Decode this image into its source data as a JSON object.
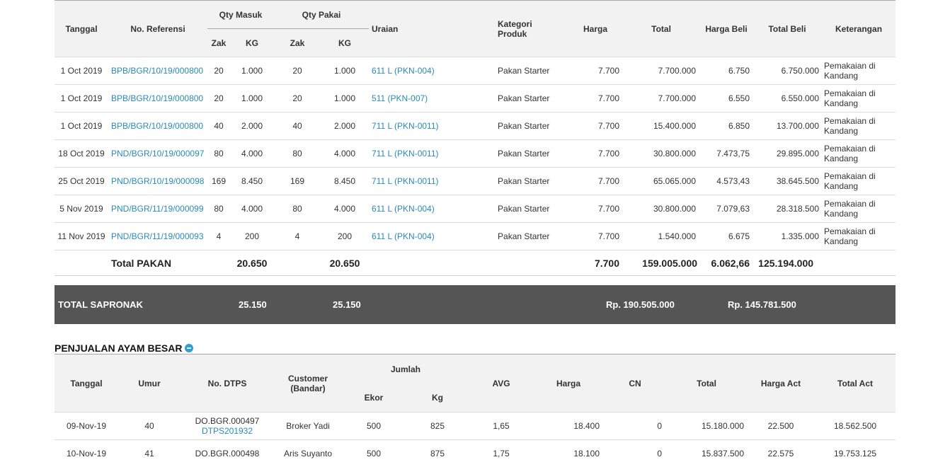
{
  "pakan": {
    "headers": {
      "tanggal": "Tanggal",
      "no_ref": "No. Referensi",
      "qty_masuk": "Qty Masuk",
      "qty_pakai": "Qty Pakai",
      "zak": "Zak",
      "kg": "KG",
      "uraian": "Uraian",
      "kategori": "Kategori Produk",
      "harga": "Harga",
      "total": "Total",
      "harga_beli": "Harga Beli",
      "total_beli": "Total Beli",
      "keterangan": "Keterangan"
    },
    "rows": [
      {
        "tanggal": "1 Oct 2019",
        "ref": "BPB/BGR/10/19/000800",
        "zak_in": "20",
        "kg_in": "1.000",
        "zak_use": "20",
        "kg_use": "1.000",
        "uraian": "611 L (PKN-004)",
        "kategori": "Pakan Starter",
        "harga": "7.700",
        "total": "7.700.000",
        "harga_beli": "6.750",
        "total_beli": "6.750.000",
        "ket": "Pemakaian di Kandang"
      },
      {
        "tanggal": "1 Oct 2019",
        "ref": "BPB/BGR/10/19/000800",
        "zak_in": "20",
        "kg_in": "1.000",
        "zak_use": "20",
        "kg_use": "1.000",
        "uraian": "511 (PKN-007)",
        "kategori": "Pakan Starter",
        "harga": "7.700",
        "total": "7.700.000",
        "harga_beli": "6.550",
        "total_beli": "6.550.000",
        "ket": "Pemakaian di Kandang"
      },
      {
        "tanggal": "1 Oct 2019",
        "ref": "BPB/BGR/10/19/000800",
        "zak_in": "40",
        "kg_in": "2.000",
        "zak_use": "40",
        "kg_use": "2.000",
        "uraian": "711 L (PKN-0011)",
        "kategori": "Pakan Starter",
        "harga": "7.700",
        "total": "15.400.000",
        "harga_beli": "6.850",
        "total_beli": "13.700.000",
        "ket": "Pemakaian di Kandang"
      },
      {
        "tanggal": "18 Oct 2019",
        "ref": "PND/BGR/10/19/000097",
        "zak_in": "80",
        "kg_in": "4.000",
        "zak_use": "80",
        "kg_use": "4.000",
        "uraian": "711 L (PKN-0011)",
        "kategori": "Pakan Starter",
        "harga": "7.700",
        "total": "30.800.000",
        "harga_beli": "7.473,75",
        "total_beli": "29.895.000",
        "ket": "Pemakaian di Kandang"
      },
      {
        "tanggal": "25 Oct 2019",
        "ref": "PND/BGR/10/19/000098",
        "zak_in": "169",
        "kg_in": "8.450",
        "zak_use": "169",
        "kg_use": "8.450",
        "uraian": "711 L (PKN-0011)",
        "kategori": "Pakan Starter",
        "harga": "7.700",
        "total": "65.065.000",
        "harga_beli": "4.573,43",
        "total_beli": "38.645.500",
        "ket": "Pemakaian di Kandang"
      },
      {
        "tanggal": "5 Nov 2019",
        "ref": "PND/BGR/11/19/000099",
        "zak_in": "80",
        "kg_in": "4.000",
        "zak_use": "80",
        "kg_use": "4.000",
        "uraian": "611 L (PKN-004)",
        "kategori": "Pakan Starter",
        "harga": "7.700",
        "total": "30.800.000",
        "harga_beli": "7.079,63",
        "total_beli": "28.318.500",
        "ket": "Pemakaian di Kandang"
      },
      {
        "tanggal": "11 Nov 2019",
        "ref": "PND/BGR/11/19/000093",
        "zak_in": "4",
        "kg_in": "200",
        "zak_use": "4",
        "kg_use": "200",
        "uraian": "611 L (PKN-004)",
        "kategori": "Pakan Starter",
        "harga": "7.700",
        "total": "1.540.000",
        "harga_beli": "6.675",
        "total_beli": "1.335.000",
        "ket": "Pemakaian di Kandang"
      }
    ],
    "total": {
      "label": "Total PAKAN",
      "kg_in": "20.650",
      "kg_use": "20.650",
      "harga": "7.700",
      "total": "159.005.000",
      "harga_beli": "6.062,66",
      "total_beli": "125.194.000"
    }
  },
  "sapronak": {
    "label": "TOTAL SAPRONAK",
    "kg_in": "25.150",
    "kg_use": "25.150",
    "total": "Rp. 190.505.000",
    "total_beli": "Rp. 145.781.500"
  },
  "ayam": {
    "title": "PENJUALAN AYAM BESAR",
    "headers": {
      "tanggal": "Tanggal",
      "umur": "Umur",
      "no_dtps": "No. DTPS",
      "customer": "Customer (Bandar)",
      "jumlah": "Jumlah",
      "ekor": "Ekor",
      "kg": "Kg",
      "avg": "AVG",
      "harga": "Harga",
      "cn": "CN",
      "total": "Total",
      "harga_act": "Harga Act",
      "total_act": "Total Act"
    },
    "rows": [
      {
        "tanggal": "09-Nov-19",
        "umur": "40",
        "do": "DO.BGR.000497",
        "dtps": "DTPS201932",
        "customer": "Broker Yadi",
        "ekor": "500",
        "kg": "825",
        "avg": "1,65",
        "harga": "18.400",
        "cn": "0",
        "total": "15.180.000",
        "harga_act": "22.500",
        "total_act": "18.562.500"
      },
      {
        "tanggal": "10-Nov-19",
        "umur": "41",
        "do": "DO.BGR.000498",
        "dtps": "",
        "customer": "Aris Suyanto",
        "ekor": "500",
        "kg": "875",
        "avg": "1,75",
        "harga": "18.100",
        "cn": "0",
        "total": "15.837.500",
        "harga_act": "22.575",
        "total_act": "19.753.125"
      }
    ]
  }
}
